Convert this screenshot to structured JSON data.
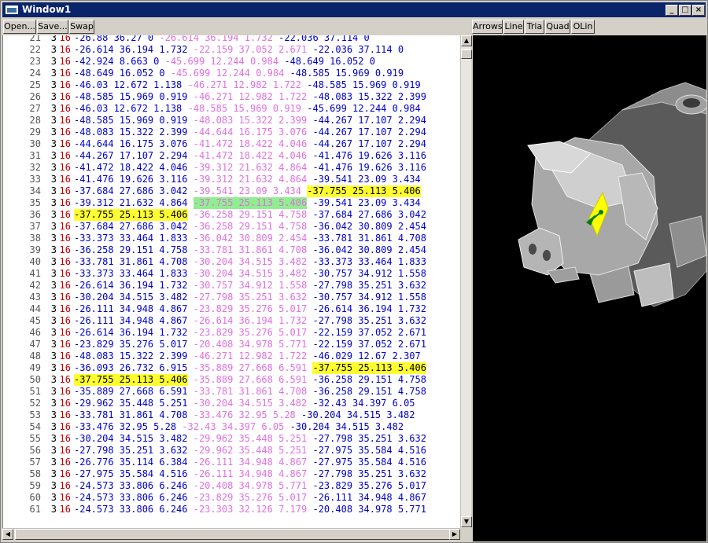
{
  "window": {
    "title": "Window1"
  },
  "toolbar": {
    "open_label": "Open...",
    "save_label": "Save...",
    "swap_label": "Swap",
    "arrows_label": "Arrows",
    "line_label": "Line",
    "tria_label": "Tria",
    "quad_label": "Quad",
    "olin_label": "OLin"
  },
  "titlebar_buttons": {
    "minimize": "_",
    "maximize": "□",
    "close": "×"
  },
  "listing": {
    "rows": [
      {
        "ln": "21",
        "a": "3",
        "b": "16",
        "v1": "-26.88 36.27 0",
        "v2": "-26.614 36.194 1.732",
        "v3": "-22.036 37.114 0"
      },
      {
        "ln": "22",
        "a": "3",
        "b": "16",
        "v1": "-26.614 36.194 1.732",
        "v2": "-22.159 37.052 2.671",
        "v3": "-22.036 37.114 0"
      },
      {
        "ln": "23",
        "a": "3",
        "b": "16",
        "v1": "-42.924 8.663 0",
        "v2": "-45.699 12.244 0.984",
        "v3": "-48.649 16.052 0"
      },
      {
        "ln": "24",
        "a": "3",
        "b": "16",
        "v1": "-48.649 16.052 0",
        "v2": "-45.699 12.244 0.984",
        "v3": "-48.585 15.969 0.919"
      },
      {
        "ln": "25",
        "a": "3",
        "b": "16",
        "v1": "-46.03 12.672 1.138",
        "v2": "-46.271 12.982 1.722",
        "v3": "-48.585 15.969 0.919"
      },
      {
        "ln": "26",
        "a": "3",
        "b": "16",
        "v1": "-48.585 15.969 0.919",
        "v2": "-46.271 12.982 1.722",
        "v3": "-48.083 15.322 2.399"
      },
      {
        "ln": "27",
        "a": "3",
        "b": "16",
        "v1": "-46.03 12.672 1.138",
        "v2": "-48.585 15.969 0.919",
        "v3": "-45.699 12.244 0.984"
      },
      {
        "ln": "28",
        "a": "3",
        "b": "16",
        "v1": "-48.585 15.969 0.919",
        "v2": "-48.083 15.322 2.399",
        "v3": "-44.267 17.107 2.294"
      },
      {
        "ln": "29",
        "a": "3",
        "b": "16",
        "v1": "-48.083 15.322 2.399",
        "v2": "-44.644 16.175 3.076",
        "v3": "-44.267 17.107 2.294"
      },
      {
        "ln": "30",
        "a": "3",
        "b": "16",
        "v1": "-44.644 16.175 3.076",
        "v2": "-41.472 18.422 4.046",
        "v3": "-44.267 17.107 2.294"
      },
      {
        "ln": "31",
        "a": "3",
        "b": "16",
        "v1": "-44.267 17.107 2.294",
        "v2": "-41.472 18.422 4.046",
        "v3": "-41.476 19.626 3.116"
      },
      {
        "ln": "32",
        "a": "3",
        "b": "16",
        "v1": "-41.472 18.422 4.046",
        "v2": "-39.312 21.632 4.864",
        "v3": "-41.476 19.626 3.116"
      },
      {
        "ln": "33",
        "a": "3",
        "b": "16",
        "v1": "-41.476 19.626 3.116",
        "v2": "-39.312 21.632 4.864",
        "v3": "-39.541 23.09 3.434"
      },
      {
        "ln": "34",
        "a": "3",
        "b": "16",
        "v1": "-37.684 27.686 3.042",
        "v2": "-39.541 23.09 3.434",
        "v3": "-37.755 25.113 5.406",
        "hl3": "y"
      },
      {
        "ln": "35",
        "a": "3",
        "b": "16",
        "v1": "-39.312 21.632 4.864",
        "v2": "-37.755 25.113 5.406",
        "v3": "-39.541 23.09 3.434",
        "hl2": "g"
      },
      {
        "ln": "36",
        "a": "3",
        "b": "16",
        "v1": "-37.755 25.113 5.406",
        "v2": "-36.258 29.151 4.758",
        "v3": "-37.684 27.686 3.042",
        "hl1": "y"
      },
      {
        "ln": "37",
        "a": "3",
        "b": "16",
        "v1": "-37.684 27.686 3.042",
        "v2": "-36.258 29.151 4.758",
        "v3": "-36.042 30.809 2.454"
      },
      {
        "ln": "38",
        "a": "3",
        "b": "16",
        "v1": "-33.373 33.464 1.833",
        "v2": "-36.042 30.809 2.454",
        "v3": "-33.781 31.861 4.708"
      },
      {
        "ln": "39",
        "a": "3",
        "b": "16",
        "v1": "-36.258 29.151 4.758",
        "v2": "-33.781 31.861 4.708",
        "v3": "-36.042 30.809 2.454"
      },
      {
        "ln": "40",
        "a": "3",
        "b": "16",
        "v1": "-33.781 31.861 4.708",
        "v2": "-30.204 34.515 3.482",
        "v3": "-33.373 33.464 1.833"
      },
      {
        "ln": "41",
        "a": "3",
        "b": "16",
        "v1": "-33.373 33.464 1.833",
        "v2": "-30.204 34.515 3.482",
        "v3": "-30.757 34.912 1.558"
      },
      {
        "ln": "42",
        "a": "3",
        "b": "16",
        "v1": "-26.614 36.194 1.732",
        "v2": "-30.757 34.912 1.558",
        "v3": "-27.798 35.251 3.632"
      },
      {
        "ln": "43",
        "a": "3",
        "b": "16",
        "v1": "-30.204 34.515 3.482",
        "v2": "-27.798 35.251 3.632",
        "v3": "-30.757 34.912 1.558"
      },
      {
        "ln": "44",
        "a": "3",
        "b": "16",
        "v1": "-26.111 34.948 4.867",
        "v2": "-23.829 35.276 5.017",
        "v3": "-26.614 36.194 1.732"
      },
      {
        "ln": "45",
        "a": "3",
        "b": "16",
        "v1": "-26.111 34.948 4.867",
        "v2": "-26.614 36.194 1.732",
        "v3": "-27.798 35.251 3.632"
      },
      {
        "ln": "46",
        "a": "3",
        "b": "16",
        "v1": "-26.614 36.194 1.732",
        "v2": "-23.829 35.276 5.017",
        "v3": "-22.159 37.052 2.671"
      },
      {
        "ln": "47",
        "a": "3",
        "b": "16",
        "v1": "-23.829 35.276 5.017",
        "v2": "-20.408 34.978 5.771",
        "v3": "-22.159 37.052 2.671"
      },
      {
        "ln": "48",
        "a": "3",
        "b": "16",
        "v1": "-48.083 15.322 2.399",
        "v2": "-46.271 12.982 1.722",
        "v3": "-46.029 12.67 2.307"
      },
      {
        "ln": "49",
        "a": "3",
        "b": "16",
        "v1": "-36.093 26.732 6.915",
        "v2": "-35.889 27.668 6.591",
        "v3": "-37.755 25.113 5.406",
        "hl3": "y"
      },
      {
        "ln": "50",
        "a": "3",
        "b": "16",
        "v1": "-37.755 25.113 5.406",
        "v2": "-35.889 27.668 6.591",
        "v3": "-36.258 29.151 4.758",
        "hl1": "y"
      },
      {
        "ln": "51",
        "a": "3",
        "b": "16",
        "v1": "-35.889 27.668 6.591",
        "v2": "-33.781 31.861 4.708",
        "v3": "-36.258 29.151 4.758"
      },
      {
        "ln": "52",
        "a": "3",
        "b": "16",
        "v1": "-29.962 35.448 5.251",
        "v2": "-30.204 34.515 3.482",
        "v3": "-32.43 34.397 6.05"
      },
      {
        "ln": "53",
        "a": "3",
        "b": "16",
        "v1": "-33.781 31.861 4.708",
        "v2": "-33.476 32.95 5.28",
        "v3": "-30.204 34.515 3.482"
      },
      {
        "ln": "54",
        "a": "3",
        "b": "16",
        "v1": "-33.476 32.95 5.28",
        "v2": "-32.43 34.397 6.05",
        "v3": "-30.204 34.515 3.482"
      },
      {
        "ln": "55",
        "a": "3",
        "b": "16",
        "v1": "-30.204 34.515 3.482",
        "v2": "-29.962 35.448 5.251",
        "v3": "-27.798 35.251 3.632"
      },
      {
        "ln": "56",
        "a": "3",
        "b": "16",
        "v1": "-27.798 35.251 3.632",
        "v2": "-29.962 35.448 5.251",
        "v3": "-27.975 35.584 4.516"
      },
      {
        "ln": "57",
        "a": "3",
        "b": "16",
        "v1": "-26.776 35.114 6.384",
        "v2": "-26.111 34.948 4.867",
        "v3": "-27.975 35.584 4.516"
      },
      {
        "ln": "58",
        "a": "3",
        "b": "16",
        "v1": "-27.975 35.584 4.516",
        "v2": "-26.111 34.948 4.867",
        "v3": "-27.798 35.251 3.632"
      },
      {
        "ln": "59",
        "a": "3",
        "b": "16",
        "v1": "-24.573 33.806 6.246",
        "v2": "-20.408 34.978 5.771",
        "v3": "-23.829 35.276 5.017"
      },
      {
        "ln": "60",
        "a": "3",
        "b": "16",
        "v1": "-24.573 33.806 6.246",
        "v2": "-23.829 35.276 5.017",
        "v3": "-26.111 34.948 4.867"
      },
      {
        "ln": "61",
        "a": "3",
        "b": "16",
        "v1": "-24.573 33.806 6.246",
        "v2": "-23.303 32.126 7.179",
        "v3": "-20.408 34.978 5.771"
      }
    ]
  },
  "viewer": {
    "model": "pig mesh",
    "background_color": "#000000",
    "highlight_color": "#ffff00",
    "marker_color": "#008000"
  }
}
